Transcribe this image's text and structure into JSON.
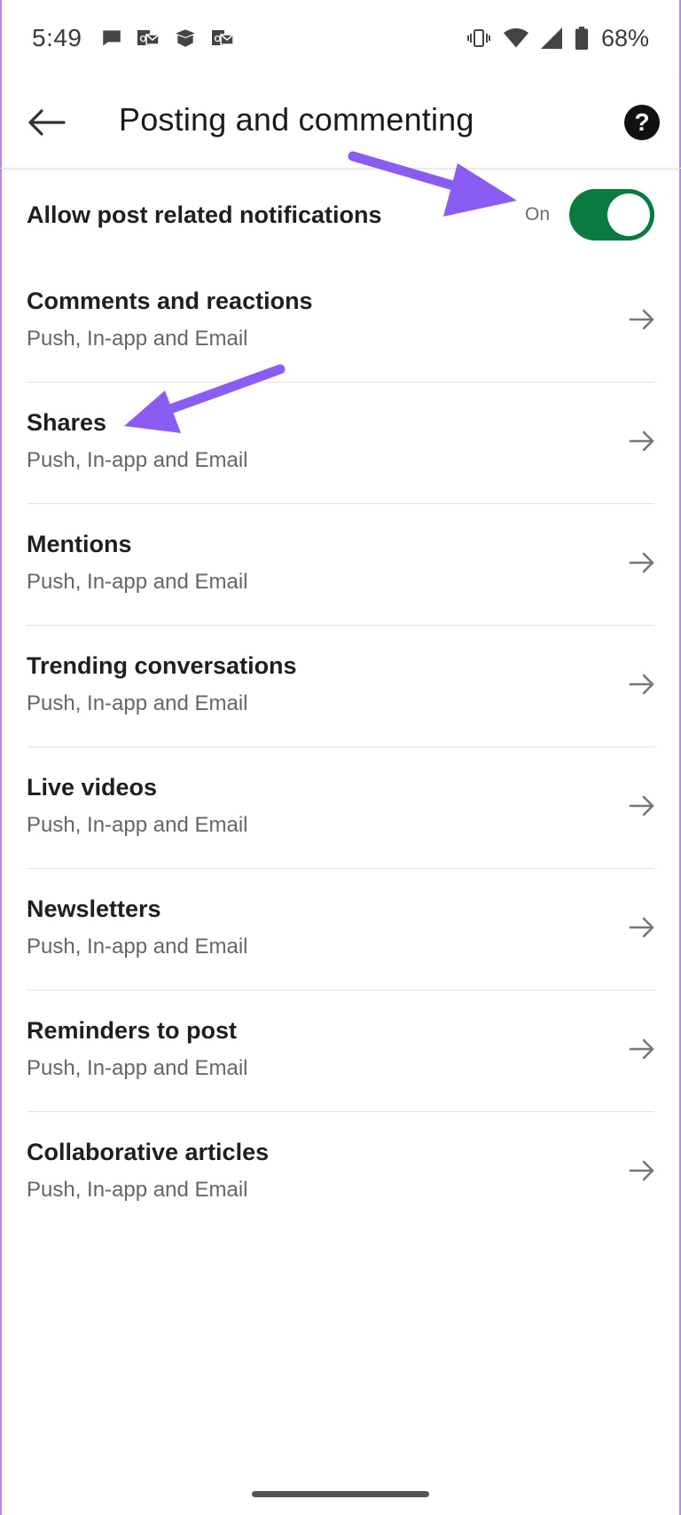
{
  "status_bar": {
    "time": "5:49",
    "battery": "68%",
    "icons": [
      "chat-bubble-icon",
      "email-icon",
      "box-icon",
      "email-icon",
      "vibrate-icon",
      "wifi-icon",
      "signal-icon",
      "battery-icon"
    ]
  },
  "header": {
    "title": "Posting and commenting",
    "back_icon": "arrow-left-icon",
    "help_icon": "help-icon",
    "help_glyph": "?"
  },
  "toggle": {
    "label": "Allow post related notifications",
    "state_text": "On",
    "enabled": true,
    "color": "#0a7a40"
  },
  "items": [
    {
      "title": "Comments and reactions",
      "subtitle": "Push, In-app and Email"
    },
    {
      "title": "Shares",
      "subtitle": "Push, In-app and Email"
    },
    {
      "title": "Mentions",
      "subtitle": "Push, In-app and Email"
    },
    {
      "title": "Trending conversations",
      "subtitle": "Push, In-app and Email"
    },
    {
      "title": "Live videos",
      "subtitle": "Push, In-app and Email"
    },
    {
      "title": "Newsletters",
      "subtitle": "Push, In-app and Email"
    },
    {
      "title": "Reminders to post",
      "subtitle": "Push, In-app and Email"
    },
    {
      "title": "Collaborative articles",
      "subtitle": "Push, In-app and Email"
    }
  ],
  "colors": {
    "accent": "#0a7a40",
    "annotation": "#8a5cf2"
  }
}
